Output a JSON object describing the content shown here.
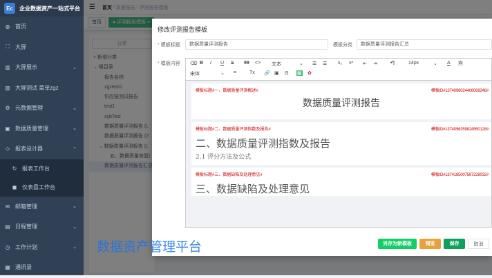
{
  "app": {
    "title": "企业数据资产一站式平台",
    "logo_text": "Ec"
  },
  "sidebar": {
    "items": [
      {
        "icon": "dashboard-icon",
        "label": "首页"
      },
      {
        "icon": "screen-icon",
        "label": "大屏"
      },
      {
        "icon": "chart-icon",
        "label": "大屏展示"
      },
      {
        "icon": "chart-icon",
        "label": "大屏测试 菜单zgz"
      },
      {
        "icon": "gear-icon",
        "label": "元数据管理"
      },
      {
        "icon": "database-icon",
        "label": "数据质量管理"
      },
      {
        "icon": "report-icon",
        "label": "报表设计器"
      },
      {
        "icon": "sync-icon",
        "label": "报表工作台"
      },
      {
        "icon": "screen-icon",
        "label": "仪表盘工作台"
      },
      {
        "icon": "mail-icon",
        "label": "邮箱管理"
      },
      {
        "icon": "calendar-icon",
        "label": "日程管理"
      },
      {
        "icon": "plan-icon",
        "label": "工作计划"
      },
      {
        "icon": "contacts-icon",
        "label": "通讯录"
      }
    ]
  },
  "topbar": {
    "breadcrumb": [
      "首页",
      "质量报告",
      "评测报告模板"
    ]
  },
  "tags": [
    "首页",
    "● 评测报告模板 ×"
  ],
  "tree": {
    "search_placeholder": "分类",
    "nodes": [
      "+ 新增分类",
      "⌄ 根目录",
      "报告名称",
      "zgztest1",
      "供应链测试报告",
      "test1",
      "zybTest",
      "数据质量评测报告 (L",
      "数据质量评测报告 (Z",
      "⌄ 数据质量评测报告 (L",
      "五、数据质量修复)",
      "数据质量评测报告汇总"
    ]
  },
  "watermark": "数据资产管理平台",
  "modal": {
    "title": "修改评测报告模板",
    "name_label": "模板标题",
    "name_value": "数据质量评测报告",
    "category_label": "模板分类",
    "category_value": "数据质量评测报告汇总",
    "content_label": "模板内容",
    "toolbar": {
      "row1": [
        "⌫",
        "B",
        "I",
        "U",
        "S",
        "99",
        "<>",
        "文本",
        "⌄",
        "☰",
        "☰",
        "x₂",
        "x²",
        "⇤",
        "⇥",
        "•¶",
        "14px",
        "⌄",
        "A",
        "A"
      ],
      "row2": [
        "宋体",
        "⌄",
        "≡",
        "Tx",
        "🔗",
        "▣",
        "⊟",
        "▦",
        "✿"
      ]
    },
    "sections": [
      {
        "left": "模板标题#一、数据质量评测概述#",
        "right": "模板ID#1374096024406069248#",
        "title": "数据质量评测报告",
        "sub": ""
      },
      {
        "left": "模板标题#二、数据质量评测指数及报告#",
        "right": "模板ID#1374096359824560128#",
        "title": "二、数据质量评测指数及报告",
        "sub": "2.1 评分方法及公式"
      },
      {
        "left": "模板标题#三、数据缺陷及处理意见#",
        "right": "模板ID#1374185007597228032#",
        "title": "三、数据缺陷及处理意见",
        "sub": ""
      }
    ],
    "buttons": {
      "save_as": "另存为新模板",
      "preview": "预览",
      "save": "保存",
      "cancel": "取消"
    }
  }
}
